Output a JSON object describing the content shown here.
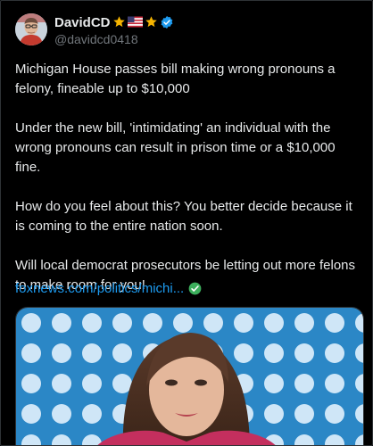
{
  "author": {
    "display_name": "DavidCD",
    "handle": "@davidcd0418",
    "avatar_icon": "avatar-portrait",
    "badges": [
      "star-emoji",
      "us-flag-emoji",
      "star-emoji",
      "verified-badge-icon"
    ]
  },
  "tweet": {
    "paragraphs": [
      "Michigan House passes bill making wrong pronouns a felony, fineable up to $10,000",
      "Under the new bill, 'intimidating' an individual with the wrong pronouns can result in prison time or a $10,000 fine.",
      "How do you feel about this?  You better decide because it is coming to the entire nation soon.",
      "Will local democrat prosecutors be letting out more felons to make room for you!"
    ],
    "link_text": "foxnews.com/politics/michi...",
    "link_icon": "green-check-emoji"
  },
  "media": {
    "type": "photo",
    "description_icon": "news-photo"
  },
  "colors": {
    "background": "#000000",
    "text": "#e7e9ea",
    "secondary": "#71767b",
    "link": "#1d9bf0",
    "verified": "#1d9bf0",
    "media_bg": "#2a86c4"
  }
}
